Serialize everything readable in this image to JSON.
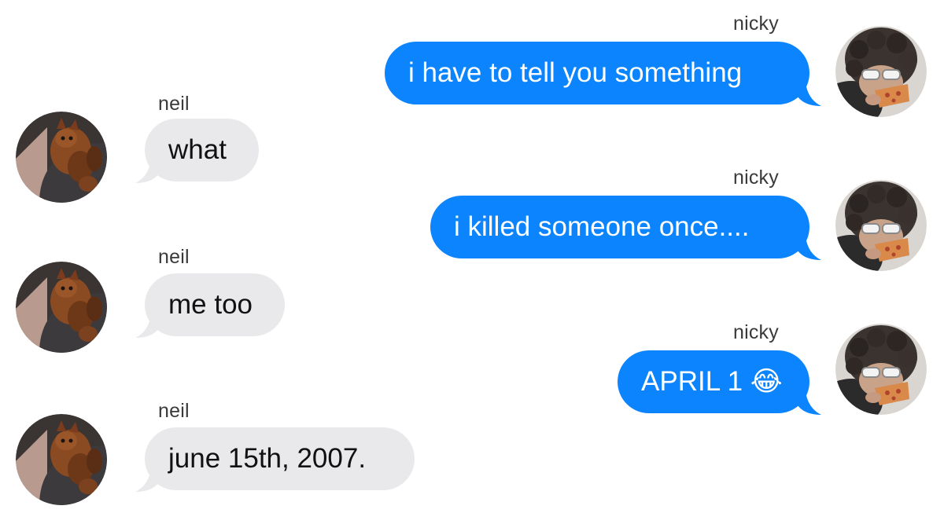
{
  "conversation": {
    "messages": [
      {
        "sender": "nicky",
        "text": "i have to tell you something",
        "direction": "outgoing",
        "avatar_icon": "nicky-avatar-icon"
      },
      {
        "sender": "neil",
        "text": "what",
        "direction": "incoming",
        "avatar_icon": "neil-avatar-icon"
      },
      {
        "sender": "nicky",
        "text": "i killed someone once....",
        "direction": "outgoing",
        "avatar_icon": "nicky-avatar-icon"
      },
      {
        "sender": "neil",
        "text": "me too",
        "direction": "incoming",
        "avatar_icon": "neil-avatar-icon"
      },
      {
        "sender": "nicky",
        "text": "APRIL 1 😂",
        "direction": "outgoing",
        "avatar_icon": "nicky-avatar-icon"
      },
      {
        "sender": "neil",
        "text": "june 15th, 2007.",
        "direction": "incoming",
        "avatar_icon": "neil-avatar-icon"
      }
    ]
  },
  "colors": {
    "outgoing_bubble": "#0b84fe",
    "incoming_bubble": "#e9e9eb",
    "outgoing_text": "#ffffff",
    "incoming_text": "#111111",
    "sender_label": "#3a3a3c"
  }
}
